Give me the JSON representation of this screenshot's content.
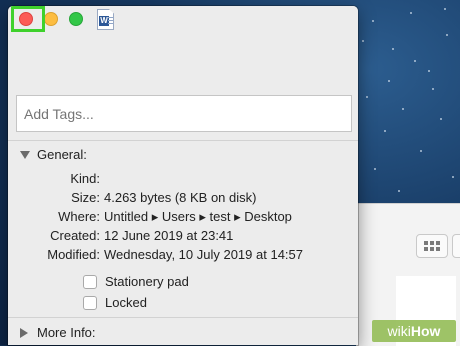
{
  "titlebar": {
    "buttons": [
      "close",
      "minimize",
      "zoom"
    ],
    "file_icon": "word-document-icon",
    "file_icon_letter": "W"
  },
  "tags": {
    "placeholder": "Add Tags..."
  },
  "general": {
    "heading": "General:",
    "rows": [
      {
        "label": "Kind:",
        "value": ""
      },
      {
        "label": "Size:",
        "value": "4.263 bytes (8 KB on disk)"
      },
      {
        "label": "Where:",
        "value": "Untitled ▸ Users ▸ test ▸ Desktop"
      },
      {
        "label": "Created:",
        "value": "12 June 2019 at 23:41"
      },
      {
        "label": "Modified:",
        "value": "Wednesday, 10 July 2019 at 14:57"
      }
    ],
    "checkboxes": [
      {
        "label": "Stationery pad",
        "checked": false
      },
      {
        "label": "Locked",
        "checked": false
      }
    ]
  },
  "more_info": {
    "heading": "More Info:"
  },
  "watermark": {
    "prefix": "wiki",
    "suffix": "How"
  },
  "colors": {
    "close": "#fc5b57",
    "minimize": "#fdbd41",
    "zoom": "#33c748",
    "highlight": "#3fd12c",
    "window_bg": "#ececec"
  }
}
